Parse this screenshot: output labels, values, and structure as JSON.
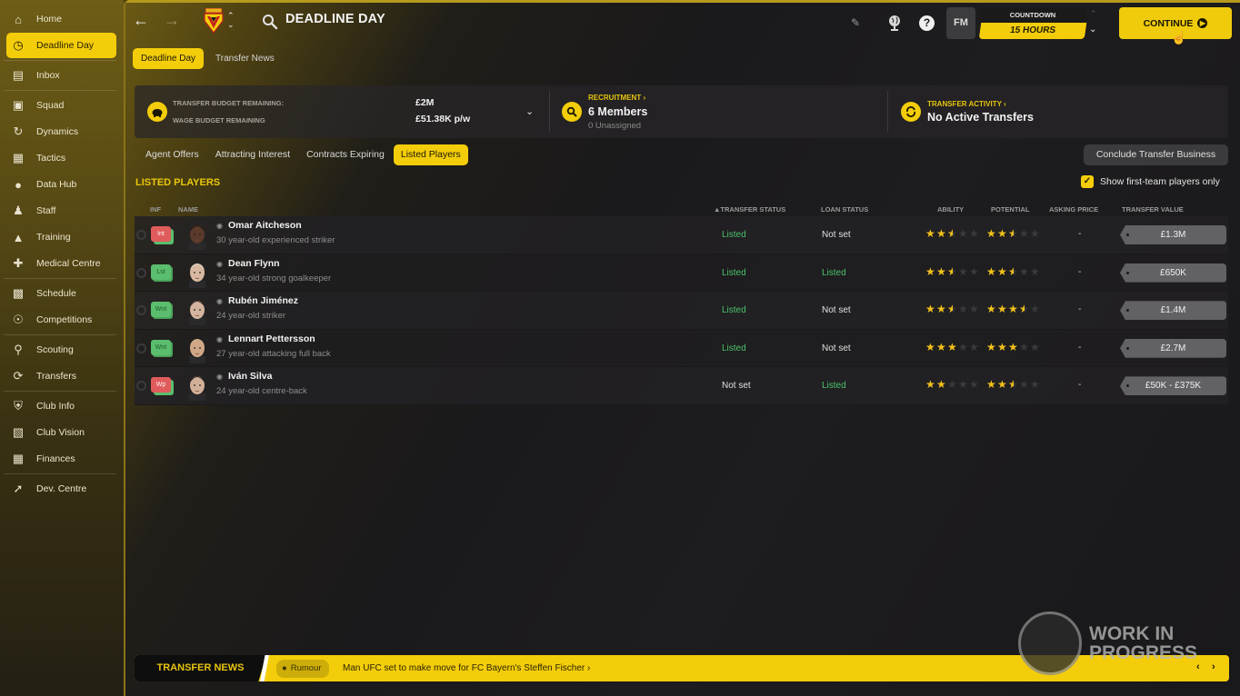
{
  "sidebar": {
    "items": [
      {
        "label": "Home",
        "icon": "home-icon"
      },
      {
        "label": "Deadline Day",
        "icon": "clock-icon",
        "active": true
      },
      {
        "label": "Inbox",
        "icon": "inbox-icon"
      },
      {
        "label": "Squad",
        "icon": "shirt-icon"
      },
      {
        "label": "Dynamics",
        "icon": "dynamics-icon"
      },
      {
        "label": "Tactics",
        "icon": "tactics-icon"
      },
      {
        "label": "Data Hub",
        "icon": "data-hub-icon"
      },
      {
        "label": "Staff",
        "icon": "staff-icon"
      },
      {
        "label": "Training",
        "icon": "training-icon"
      },
      {
        "label": "Medical Centre",
        "icon": "medical-icon"
      },
      {
        "label": "Schedule",
        "icon": "calendar-icon"
      },
      {
        "label": "Competitions",
        "icon": "trophy-icon"
      },
      {
        "label": "Scouting",
        "icon": "search-icon"
      },
      {
        "label": "Transfers",
        "icon": "transfer-icon"
      },
      {
        "label": "Club Info",
        "icon": "shield-icon"
      },
      {
        "label": "Club Vision",
        "icon": "briefcase-icon"
      },
      {
        "label": "Finances",
        "icon": "money-icon"
      },
      {
        "label": "Dev. Centre",
        "icon": "graph-icon"
      }
    ]
  },
  "header": {
    "title": "DEADLINE DAY",
    "countdown_label": "COUNTDOWN",
    "countdown_value": "15 HOURS",
    "fm_label": "FM",
    "help_label": "?",
    "continue_label": "CONTINUE"
  },
  "subtabs": [
    {
      "label": "Deadline Day",
      "active": true
    },
    {
      "label": "Transfer News",
      "active": false
    }
  ],
  "summary": {
    "transfer_budget_label": "TRANSFER BUDGET REMAINING:",
    "transfer_budget_value": "£2M",
    "wage_budget_label": "WAGE BUDGET REMAINING",
    "wage_budget_value": "£51.38K p/w",
    "recruitment_label": "RECRUITMENT ›",
    "recruitment_value": "6 Members",
    "recruitment_sub": "0 Unassigned",
    "activity_label": "TRANSFER ACTIVITY ›",
    "activity_value": "No Active Transfers"
  },
  "filter_tabs": [
    {
      "label": "Agent Offers",
      "active": false
    },
    {
      "label": "Attracting Interest",
      "active": false
    },
    {
      "label": "Contracts Expiring",
      "active": false
    },
    {
      "label": "Listed Players",
      "active": true
    }
  ],
  "conclude_label": "Conclude Transfer Business",
  "section_title": "LISTED PLAYERS",
  "first_team_only": {
    "label": "Show first-team players only",
    "checked": true
  },
  "table": {
    "columns": {
      "inf": "INF",
      "name": "NAME",
      "transfer_status": "▲TRANSFER STATUS",
      "loan_status": "LOAN STATUS",
      "ability": "ABILITY",
      "potential": "POTENTIAL",
      "asking_price": "ASKING PRICE",
      "transfer_value": "TRANSFER VALUE"
    },
    "rows": [
      {
        "inf": "Int",
        "inf_color": "red",
        "name": "Omar Aitcheson",
        "desc": "30 year-old experienced striker",
        "transfer_status": "Listed",
        "loan_status": "Not set",
        "ability": 2.5,
        "potential": 2.5,
        "asking_price": "-",
        "transfer_value": "£1.3M",
        "skin": "#5a3a2a",
        "hair": "#1a1412"
      },
      {
        "inf": "Lst",
        "inf_color": "green",
        "name": "Dean Flynn",
        "desc": "34 year-old strong goalkeeper",
        "transfer_status": "Listed",
        "loan_status": "Listed",
        "ability": 2.5,
        "potential": 2.5,
        "asking_price": "-",
        "transfer_value": "£650K",
        "skin": "#d8b8a0",
        "hair": "#e6e2da"
      },
      {
        "inf": "Wnt",
        "inf_color": "green",
        "name": "Rubén Jiménez",
        "desc": "24 year-old striker",
        "transfer_status": "Listed",
        "loan_status": "Not set",
        "ability": 2.5,
        "potential": 3.5,
        "asking_price": "-",
        "transfer_value": "£1.4M",
        "skin": "#d4b4a0",
        "hair": "#3a2a22"
      },
      {
        "inf": "Wnt",
        "inf_color": "green",
        "name": "Lennart Pettersson",
        "desc": "27 year-old attacking full back",
        "transfer_status": "Listed",
        "loan_status": "Not set",
        "ability": 3,
        "potential": 3,
        "asking_price": "-",
        "transfer_value": "£2.7M",
        "skin": "#d0a888",
        "hair": "#c8b288"
      },
      {
        "inf": "Wp",
        "inf_color": "red",
        "name": "Iván Silva",
        "desc": "24 year-old centre-back",
        "transfer_status": "Not set",
        "loan_status": "Listed",
        "ability": 2,
        "potential": 2.5,
        "asking_price": "-",
        "transfer_value": "£50K - £375K",
        "skin": "#d2b098",
        "hair": "#141212"
      }
    ]
  },
  "ticker": {
    "label": "TRANSFER NEWS",
    "tag": "Rumour",
    "headline": "Man UFC set to make move for FC Bayern's Steffen Fischer ›"
  },
  "watermark": {
    "line1": "WORK IN",
    "line2": "PROGRESS"
  },
  "colors": {
    "accent": "#f3cd0a",
    "listed": "#4bc46b",
    "star": "#f2c21a"
  }
}
